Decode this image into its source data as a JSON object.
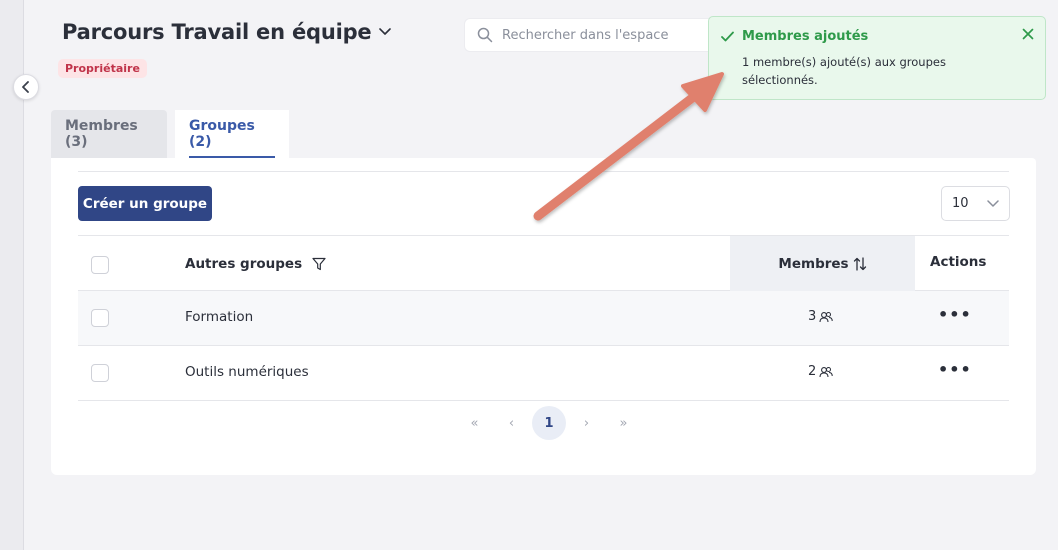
{
  "header": {
    "title": "Parcours Travail en équipe",
    "role_badge": "Propriétaire",
    "search_placeholder": "Rechercher dans l'espace"
  },
  "toast": {
    "title": "Membres ajoutés",
    "message": "1 membre(s) ajouté(s) aux groupes sélectionnés.",
    "accent": "#2e9a4a"
  },
  "tabs": [
    {
      "label": "Membres (3)",
      "active": false
    },
    {
      "label": "Groupes (2)",
      "active": true
    }
  ],
  "toolbar": {
    "create_label": "Créer un groupe",
    "page_size": "10"
  },
  "table": {
    "columns": {
      "name": "Autres groupes",
      "members": "Membres",
      "actions": "Actions"
    },
    "rows": [
      {
        "name": "Formation",
        "members": "3",
        "actions": "•••"
      },
      {
        "name": "Outils numériques",
        "members": "2",
        "actions": "•••"
      }
    ]
  },
  "pagination": {
    "first": "«",
    "prev": "‹",
    "current": "1",
    "next": "›",
    "last": "»"
  },
  "colors": {
    "primary": "#304686",
    "annotation_arrow": "#e0806d",
    "badge_bg": "#fde4e6",
    "badge_text": "#c0344a"
  }
}
